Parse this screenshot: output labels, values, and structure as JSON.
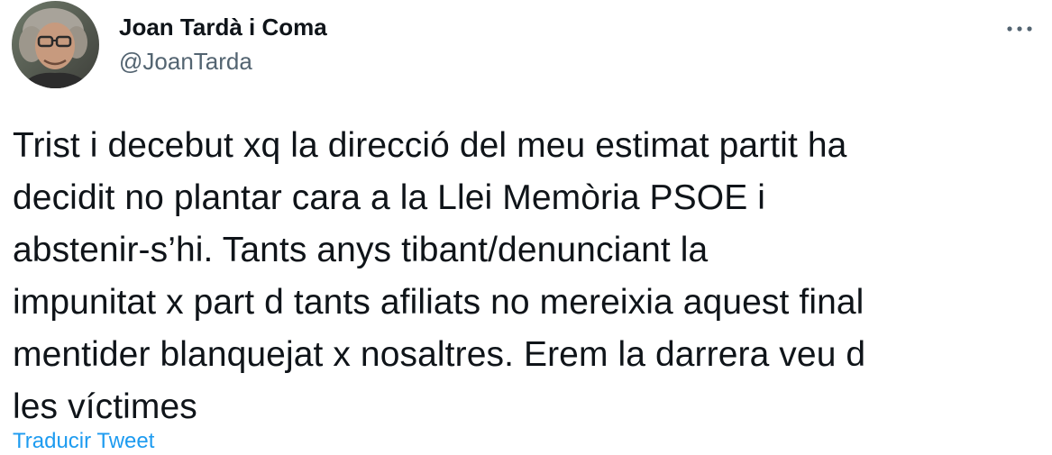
{
  "author": {
    "display_name": "Joan Tardà i Coma",
    "handle": "@JoanTarda"
  },
  "tweet": {
    "text": "Trist i decebut xq la direcció del meu estimat partit ha\ndecidit no plantar cara a la Llei Memòria PSOE i\nabstenir-s’hi. Tants anys tibant/denunciant la\nimpunitat x part d tants afiliats no mereixia aquest final\nmentider blanquejat x nosaltres. Erem la darrera veu d\nles víctimes"
  },
  "actions": {
    "translate_label": "Traducir Tweet",
    "more_icon": "more-horizontal-icon"
  },
  "colors": {
    "text": "#0f1419",
    "secondary": "#536471",
    "link": "#1d9bf0",
    "background": "#ffffff"
  }
}
